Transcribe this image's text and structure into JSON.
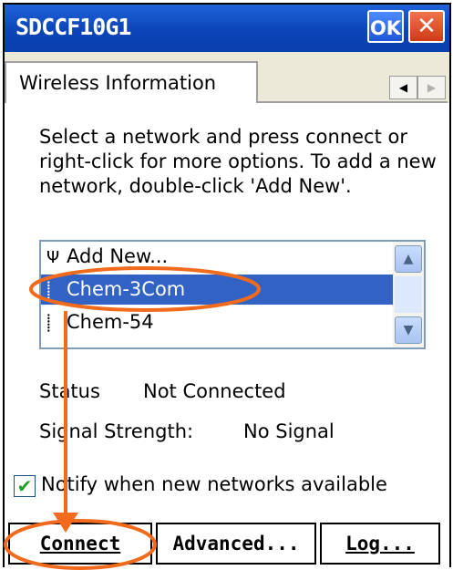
{
  "window": {
    "title": "SDCCF10G1",
    "ok_label": "OK",
    "close_label": "✕"
  },
  "tabs": {
    "active_label": "Wireless Information",
    "scroll_left": "◀",
    "scroll_right": "▶"
  },
  "instructions": "Select a network and press connect or right-click for more options.  To add a new network, double-click 'Add New'.",
  "networks": {
    "items": [
      {
        "icon": "antenna-icon",
        "glyph": "Ψ",
        "label": "Add New..."
      },
      {
        "icon": "network-icon",
        "glyph": "⸽",
        "label": "Chem-3Com",
        "selected": true
      },
      {
        "icon": "network-icon",
        "glyph": "⸽",
        "label": "Chem-54"
      }
    ],
    "scroll_up": "▲",
    "scroll_down": "▼"
  },
  "status": {
    "label": "Status",
    "value": "Not Connected"
  },
  "signal": {
    "label": "Signal Strength:",
    "value": "No Signal"
  },
  "notify": {
    "checked": true,
    "check_glyph": "✔",
    "label": "Notify when new networks available"
  },
  "buttons": {
    "connect": "Connect",
    "advanced": "Advanced...",
    "log": "Log..."
  },
  "colors": {
    "titlebar": "#0b45b8",
    "selection": "#3162c4",
    "annotation": "#f26b1d"
  }
}
